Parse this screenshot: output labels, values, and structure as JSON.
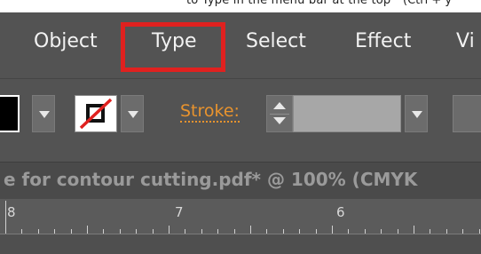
{
  "caption": {
    "text": "to Type in the menu bar at the top",
    "paren": "(Ctrl + y"
  },
  "menubar": {
    "items": [
      "Object",
      "Type",
      "Select",
      "Effect",
      "Vi"
    ],
    "highlighted": "Type",
    "highlight_color": "#e0211f"
  },
  "toolbar": {
    "fill_color": "#000000",
    "stroke_color": "none",
    "stroke_label": "Stroke:",
    "stroke_label_color": "#e8932e",
    "icons": [
      "fill-swatch",
      "dropdown-arrow",
      "stroke-none-swatch",
      "spinner-arrows"
    ]
  },
  "document": {
    "tab_title": "e for contour cutting.pdf* @ 100% (CMYK"
  },
  "ruler": {
    "labels": [
      "8",
      "7",
      "6"
    ]
  },
  "colors": {
    "panel": "#535353",
    "ruler": "#5b5b5b",
    "doc_tab": "#4a4a4a"
  }
}
